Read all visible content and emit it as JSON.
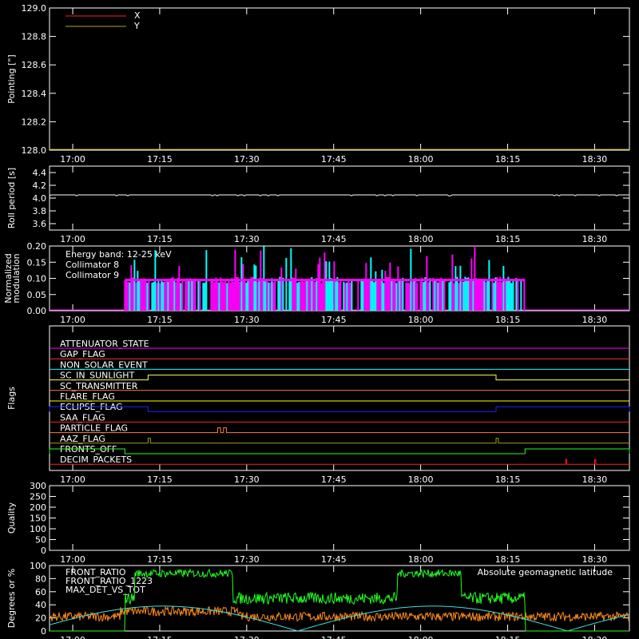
{
  "time_labels": [
    "17:00",
    "17:15",
    "17:30",
    "17:45",
    "18:00",
    "18:15",
    "18:30"
  ],
  "chart_data": [
    {
      "id": "pointing",
      "type": "line",
      "ylabel": "Pointing [\"]",
      "ylim": [
        128.0,
        129.0
      ],
      "yticks": [
        "128.0",
        "128.2",
        "128.4",
        "128.6",
        "128.8",
        "129.0"
      ],
      "legend": [
        {
          "name": "X",
          "color": "#ff2020"
        },
        {
          "name": "Y",
          "color": "#b5a020"
        }
      ],
      "series": []
    },
    {
      "id": "roll",
      "type": "line",
      "ylabel": "Roll period [s]",
      "ylim": [
        3.5,
        4.5
      ],
      "yticks": [
        "3.6",
        "3.8",
        "4.0",
        "4.2",
        "4.4"
      ],
      "series": [
        {
          "color": "#ffffff",
          "constant": 4.05
        }
      ]
    },
    {
      "id": "modulation",
      "type": "bar",
      "ylabel": "Normalized modulation",
      "ylim": [
        0,
        0.2
      ],
      "yticks": [
        "0.00",
        "0.05",
        "0.10",
        "0.15",
        "0.20"
      ],
      "annotation": "Energy band: 12-25 keV",
      "legend": [
        {
          "name": "Collimator 8",
          "color": "#00ffff"
        },
        {
          "name": "Collimator 9",
          "color": "#ff00ff"
        }
      ],
      "active_range": [
        "17:09",
        "18:18"
      ],
      "typical_value": 0.095
    },
    {
      "id": "flags",
      "type": "line",
      "ylabel": "Flags",
      "rows": [
        {
          "name": "ATTENUATOR_STATE",
          "color": "#ff00ff",
          "events": []
        },
        {
          "name": "GAP_FLAG",
          "color": "#ff3030",
          "events": []
        },
        {
          "name": "NON_SOLAR_EVENT",
          "color": "#00ffff",
          "events": []
        },
        {
          "name": "SC_IN_SUNLIGHT",
          "color": "#ffff50",
          "events": [
            [
              "17:13",
              "18:13"
            ]
          ]
        },
        {
          "name": "SC_TRANSMITTER",
          "color": "#ff8040",
          "events": []
        },
        {
          "name": "FLARE_FLAG",
          "color": "#ffff00",
          "events": []
        },
        {
          "name": "ECLIPSE_FLAG",
          "color": "#2020ff",
          "events": [
            [
              "16:56",
              "17:13"
            ],
            [
              "18:13",
              "18:36"
            ]
          ]
        },
        {
          "name": "SAA_FLAG",
          "color": "#ff2020",
          "events": []
        },
        {
          "name": "PARTICLE_FLAG",
          "color": "#ff8040",
          "events": [
            [
              "17:25",
              "17:25.5"
            ],
            [
              "17:26",
              "17:26.5"
            ]
          ]
        },
        {
          "name": "AAZ_FLAG",
          "color": "#a0a020",
          "events": [
            [
              "17:13",
              "17:13.4"
            ],
            [
              "18:13",
              "18:13.4"
            ]
          ]
        },
        {
          "name": "FRONTS_OFF",
          "color": "#20ff20",
          "events": [
            [
              "16:56",
              "17:09"
            ],
            [
              "18:18",
              "18:36"
            ]
          ]
        },
        {
          "name": "DECIM_PACKETS",
          "color": "#ff2020",
          "events": [
            [
              "18:25",
              "18:25.2"
            ],
            [
              "18:30",
              "18:30.2"
            ]
          ]
        }
      ]
    },
    {
      "id": "quality",
      "type": "line",
      "ylabel": "Quality",
      "ylim": [
        0,
        300
      ],
      "yticks": [
        "0",
        "50",
        "100",
        "150",
        "200",
        "250",
        "300"
      ],
      "series": []
    },
    {
      "id": "ratios",
      "type": "line",
      "ylabel": "Degrees or %",
      "ylim": [
        0,
        100
      ],
      "yticks": [
        "0",
        "20",
        "40",
        "60",
        "80",
        "100"
      ],
      "legend": [
        {
          "name": "FRONT_RATIO",
          "color": "#20ff20"
        },
        {
          "name": "FRONT_RATIO_1223",
          "color": "#00cc00"
        },
        {
          "name": "MAX_DET_VS_TOT",
          "color": "#ff8c1a"
        }
      ],
      "right_label": {
        "text": "Absolute geomagnetic latitude",
        "color": "#40e0e0"
      }
    }
  ]
}
